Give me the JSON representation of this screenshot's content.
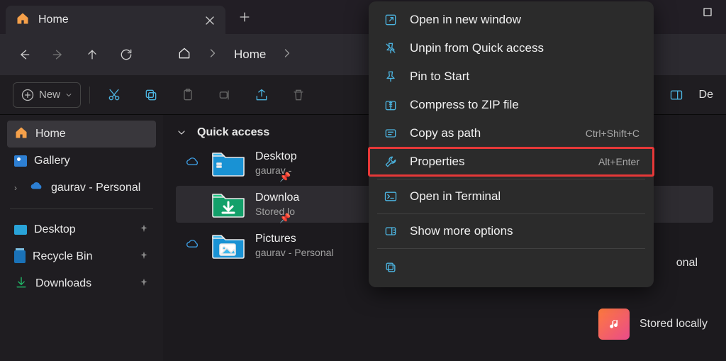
{
  "tab": {
    "title": "Home"
  },
  "breadcrumb": {
    "location": "Home"
  },
  "toolbar": {
    "new_label": "New",
    "details_btn": "De"
  },
  "sidebar": {
    "items": [
      {
        "label": "Home"
      },
      {
        "label": "Gallery"
      },
      {
        "label": "gaurav - Personal"
      },
      {
        "label": "Desktop"
      },
      {
        "label": "Recycle Bin"
      },
      {
        "label": "Downloads"
      }
    ]
  },
  "main": {
    "section_title": "Quick access",
    "quick": [
      {
        "name": "Desktop",
        "sub": "gaurav -"
      },
      {
        "name": "Downloa",
        "sub": "Stored lo"
      },
      {
        "name": "Pictures",
        "sub": "gaurav - Personal"
      }
    ],
    "right_item": {
      "sub": "Stored locally"
    },
    "right_badge": "onal"
  },
  "context_menu": {
    "items": [
      {
        "label": "Open in new window",
        "shortcut": ""
      },
      {
        "label": "Unpin from Quick access",
        "shortcut": ""
      },
      {
        "label": "Pin to Start",
        "shortcut": ""
      },
      {
        "label": "Compress to ZIP file",
        "shortcut": ""
      },
      {
        "label": "Copy as path",
        "shortcut": "Ctrl+Shift+C"
      },
      {
        "label": "Properties",
        "shortcut": "Alt+Enter"
      },
      {
        "label": "Open in Terminal",
        "shortcut": ""
      },
      {
        "label": "Show more options",
        "shortcut": ""
      }
    ]
  }
}
